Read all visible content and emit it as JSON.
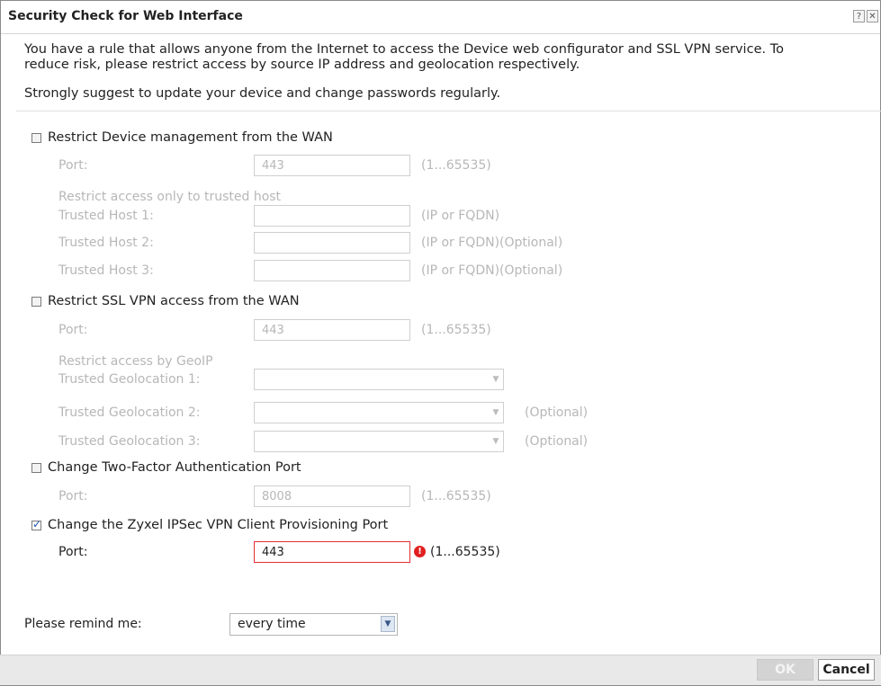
{
  "dialog": {
    "title": "Security Check for Web Interface",
    "help_btn": "?",
    "close_btn": "✕",
    "intro_line1": "You have a rule that allows anyone from the Internet to access the Device web configurator and SSL VPN service. To",
    "intro_line2": "reduce risk, please restrict access by source IP address and geolocation respectively.",
    "suggest": "Strongly suggest to update your device and change passwords regularly."
  },
  "mgmt": {
    "checkbox_label": "Restrict Device management from the WAN",
    "checked": false,
    "port_label": "Port:",
    "port_value": "443",
    "port_hint": "(1...65535)",
    "trusted_heading": "Restrict access only to trusted host",
    "host1_label": "Trusted Host 1:",
    "host1_hint": "(IP or FQDN)",
    "host2_label": "Trusted Host 2:",
    "host2_hint": "(IP or FQDN)(Optional)",
    "host3_label": "Trusted Host 3:",
    "host3_hint": "(IP or FQDN)(Optional)"
  },
  "sslvpn": {
    "checkbox_label": "Restrict SSL VPN access from the WAN",
    "checked": false,
    "port_label": "Port:",
    "port_value": "443",
    "port_hint": "(1...65535)",
    "geoip_heading": "Restrict access by GeoIP",
    "geo1_label": "Trusted Geolocation 1:",
    "geo2_label": "Trusted Geolocation 2:",
    "geo2_hint": "(Optional)",
    "geo3_label": "Trusted Geolocation 3:",
    "geo3_hint": "(Optional)"
  },
  "twofa": {
    "checkbox_label": "Change Two-Factor Authentication Port",
    "checked": false,
    "port_label": "Port:",
    "port_value": "8008",
    "port_hint": "(1...65535)"
  },
  "ipsec": {
    "checkbox_label": "Change the Zyxel IPSec VPN Client Provisioning Port",
    "checked": true,
    "port_label": "Port:",
    "port_value": "443",
    "port_hint": "(1...65535)",
    "error_icon": "!"
  },
  "remind": {
    "label": "Please remind me:",
    "selected": "every time"
  },
  "footer": {
    "ok_label": "OK",
    "cancel_label": "Cancel"
  },
  "colors": {
    "error": "#e02020",
    "disabled_text": "#b7b7b7",
    "checkbox_check": "#1a53b0"
  },
  "icons": {
    "dropdown": "chevron-down-icon",
    "error": "error-icon",
    "checkbox": "checkbox-icon"
  }
}
